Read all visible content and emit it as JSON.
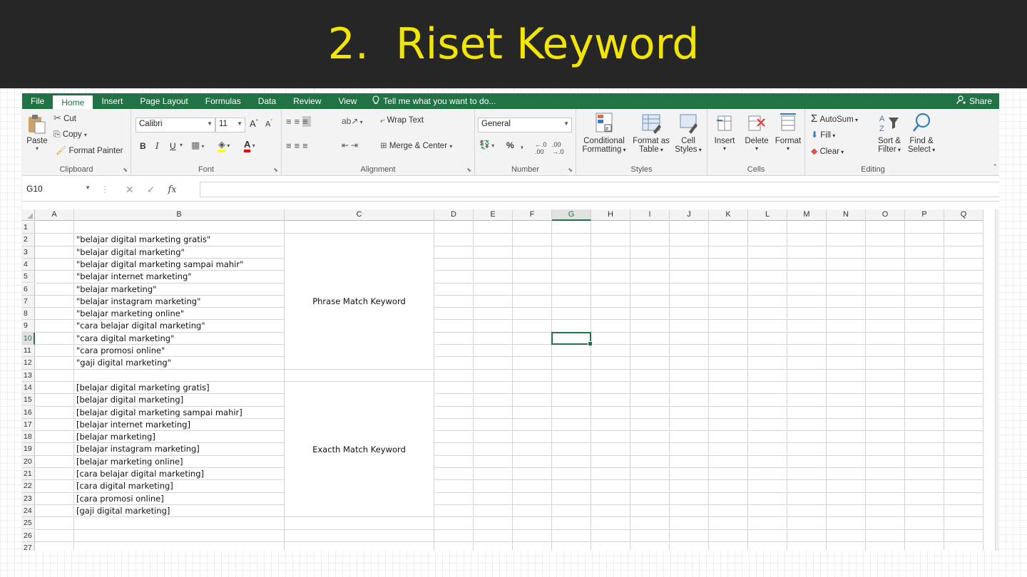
{
  "slide": {
    "number": "2.",
    "title": "Riset Keyword"
  },
  "tabs": [
    "File",
    "Home",
    "Insert",
    "Page Layout",
    "Formulas",
    "Data",
    "Review",
    "View"
  ],
  "active_tab": "Home",
  "tell_me": "Tell me what you want to do...",
  "share_label": "Share",
  "clipboard": {
    "paste": "Paste",
    "cut": "Cut",
    "copy": "Copy",
    "format_painter": "Format Painter",
    "label": "Clipboard"
  },
  "font": {
    "name": "Calibri",
    "size": "11",
    "label": "Font",
    "bold": "B",
    "italic": "I",
    "underline": "U"
  },
  "alignment": {
    "wrap": "Wrap Text",
    "merge": "Merge & Center",
    "label": "Alignment"
  },
  "number": {
    "format": "General",
    "percent": "%",
    "comma": ",",
    "label": "Number"
  },
  "styles": {
    "conditional_1": "Conditional",
    "conditional_2": "Formatting",
    "table_1": "Format as",
    "table_2": "Table",
    "cell_1": "Cell",
    "cell_2": "Styles",
    "label": "Styles"
  },
  "cells": {
    "insert": "Insert",
    "delete": "Delete",
    "format": "Format",
    "label": "Cells"
  },
  "editing": {
    "autosum": "AutoSum",
    "fill": "Fill",
    "clear": "Clear",
    "sort_1": "Sort &",
    "sort_2": "Filter",
    "find_1": "Find &",
    "find_2": "Select",
    "label": "Editing"
  },
  "name_box": "G10",
  "columns": [
    "A",
    "B",
    "C",
    "D",
    "E",
    "F",
    "G",
    "H",
    "I",
    "J",
    "K",
    "L",
    "M",
    "N",
    "O",
    "P",
    "Q"
  ],
  "selected_column": "G",
  "selected_row": "10",
  "rows": [
    "1",
    "2",
    "3",
    "4",
    "5",
    "6",
    "7",
    "8",
    "9",
    "10",
    "11",
    "12",
    "13",
    "14",
    "15",
    "16",
    "17",
    "18",
    "19",
    "20",
    "21",
    "22",
    "23",
    "24",
    "25",
    "26",
    "27"
  ],
  "phrase_keywords": [
    "\"belajar digital marketing gratis\"",
    "\"belajar digital marketing\"",
    "\"belajar digital marketing sampai mahir\"",
    "\"belajar internet marketing\"",
    "\"belajar marketing\"",
    "\"belajar instagram marketing\"",
    "\"belajar marketing online\"",
    "\"cara belajar digital marketing\"",
    "\"cara digital marketing\"",
    "\"cara promosi online\"",
    "\"gaji digital marketing\""
  ],
  "exact_keywords": [
    "[belajar digital marketing gratis]",
    "[belajar digital marketing]",
    "[belajar digital marketing sampai mahir]",
    "[belajar internet marketing]",
    "[belajar marketing]",
    "[belajar instagram marketing]",
    "[belajar marketing online]",
    "[cara belajar digital marketing]",
    "[cara digital marketing]",
    "[cara promosi online]",
    "[gaji digital marketing]"
  ],
  "phrase_label": "Phrase Match Keyword",
  "exact_label": "Exacth Match Keyword",
  "colors": {
    "accent": "#217346",
    "banner": "#262626",
    "title": "#f2e600"
  }
}
